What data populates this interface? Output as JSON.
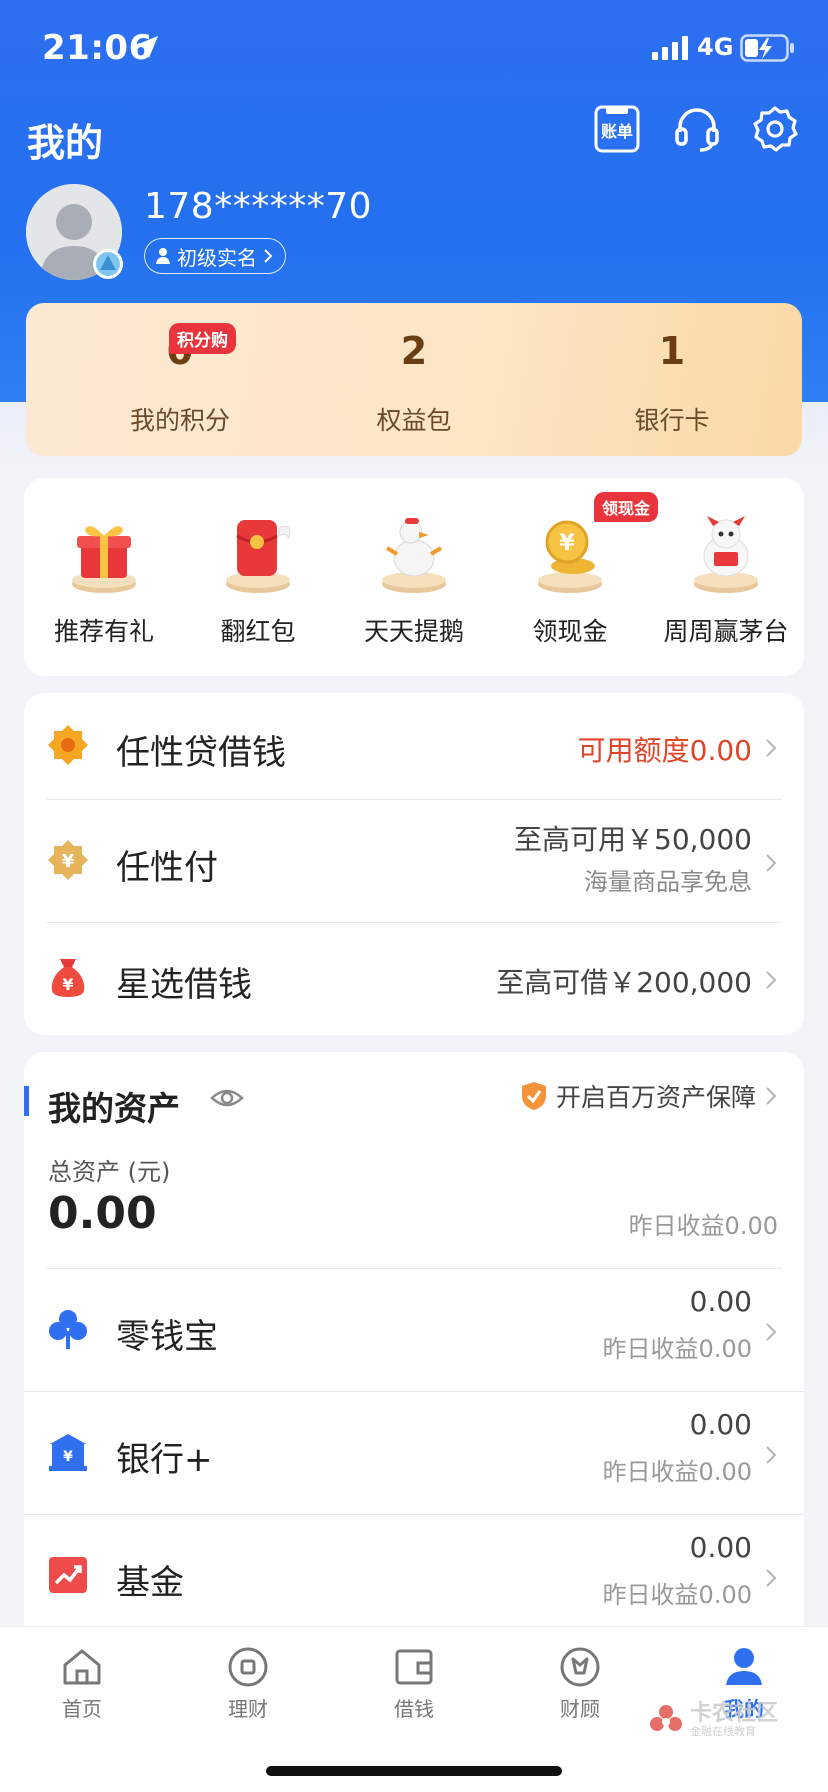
{
  "status": {
    "time": "21:06",
    "network": "4G"
  },
  "header": {
    "title": "我的",
    "bill_icon_text": "账单"
  },
  "profile": {
    "phone": "178******70",
    "realname_label": "初级实名"
  },
  "stats": [
    {
      "value": "0",
      "label": "我的积分",
      "badge": "积分购"
    },
    {
      "value": "2",
      "label": "权益包"
    },
    {
      "value": "1",
      "label": "银行卡"
    }
  ],
  "quick": [
    {
      "label": "推荐有礼",
      "icon": "gift-icon"
    },
    {
      "label": "翻红包",
      "icon": "red-envelope-icon"
    },
    {
      "label": "天天提鹅",
      "icon": "goose-icon"
    },
    {
      "label": "领现金",
      "icon": "coin-icon",
      "badge": "领现金"
    },
    {
      "label": "周周赢茅台",
      "icon": "mascot-icon"
    }
  ],
  "loans": [
    {
      "title": "任性贷借钱",
      "value": "可用额度0.00",
      "value_color": "#e0452b"
    },
    {
      "title": "任性付",
      "value": "至高可用￥50,000",
      "sub": "海量商品享免息"
    },
    {
      "title": "星选借钱",
      "value": "至高可借￥200,000"
    }
  ],
  "assets": {
    "title": "我的资产",
    "protect_label": "开启百万资产保障",
    "total_label": "总资产 (元)",
    "total_value": "0.00",
    "yesterday": "昨日收益0.00",
    "items": [
      {
        "title": "零钱宝",
        "value": "0.00",
        "sub": "昨日收益0.00"
      },
      {
        "title": "银行+",
        "value": "0.00",
        "sub": "昨日收益0.00"
      },
      {
        "title": "基金",
        "value": "0.00",
        "sub": "昨日收益0.00"
      }
    ]
  },
  "tabs": [
    {
      "label": "首页"
    },
    {
      "label": "理财"
    },
    {
      "label": "借钱"
    },
    {
      "label": "财顾"
    },
    {
      "label": "我的",
      "active": true
    }
  ],
  "watermark": {
    "title": "卡农社区",
    "subtitle": "金融在线教育"
  },
  "colors": {
    "primary": "#2d6ff0",
    "red": "#e0452b",
    "gold": "#6b3d12"
  }
}
